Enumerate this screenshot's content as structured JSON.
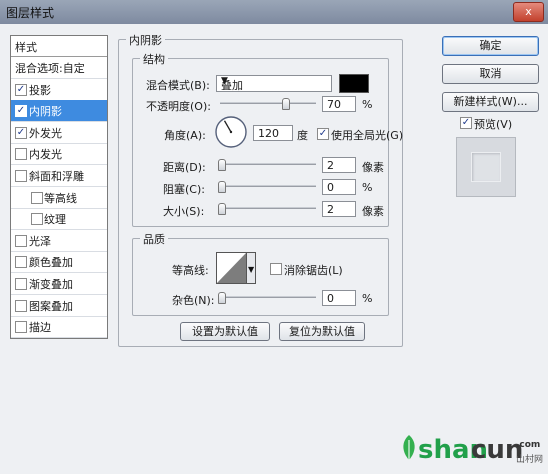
{
  "window": {
    "title": "图层样式",
    "close_label": "x"
  },
  "styles_panel": {
    "header": "样式",
    "items": [
      {
        "label": "混合选项:自定",
        "checkbox": false,
        "checked": false,
        "indent": false,
        "selected": false
      },
      {
        "label": "投影",
        "checkbox": true,
        "checked": true,
        "indent": false,
        "selected": false
      },
      {
        "label": "内阴影",
        "checkbox": true,
        "checked": true,
        "indent": false,
        "selected": true
      },
      {
        "label": "外发光",
        "checkbox": true,
        "checked": true,
        "indent": false,
        "selected": false
      },
      {
        "label": "内发光",
        "checkbox": true,
        "checked": false,
        "indent": false,
        "selected": false
      },
      {
        "label": "斜面和浮雕",
        "checkbox": true,
        "checked": false,
        "indent": false,
        "selected": false
      },
      {
        "label": "等高线",
        "checkbox": true,
        "checked": false,
        "indent": true,
        "selected": false
      },
      {
        "label": "纹理",
        "checkbox": true,
        "checked": false,
        "indent": true,
        "selected": false
      },
      {
        "label": "光泽",
        "checkbox": true,
        "checked": false,
        "indent": false,
        "selected": false
      },
      {
        "label": "颜色叠加",
        "checkbox": true,
        "checked": false,
        "indent": false,
        "selected": false
      },
      {
        "label": "渐变叠加",
        "checkbox": true,
        "checked": false,
        "indent": false,
        "selected": false
      },
      {
        "label": "图案叠加",
        "checkbox": true,
        "checked": false,
        "indent": false,
        "selected": false
      },
      {
        "label": "描边",
        "checkbox": true,
        "checked": false,
        "indent": false,
        "selected": false
      }
    ]
  },
  "inner_shadow": {
    "section_title": "内阴影",
    "structure": {
      "title": "结构",
      "blend_mode_label": "混合模式(B):",
      "blend_mode_value": "叠加",
      "shadow_color": "#000000",
      "opacity_label": "不透明度(O):",
      "opacity_value": "70",
      "opacity_unit": "%",
      "angle_label": "角度(A):",
      "angle_value": "120",
      "angle_unit": "度",
      "global_light_label": "使用全局光(G)",
      "global_light_checked": true,
      "distance_label": "距离(D):",
      "distance_value": "2",
      "distance_unit": "像素",
      "choke_label": "阻塞(C):",
      "choke_value": "0",
      "choke_unit": "%",
      "size_label": "大小(S):",
      "size_value": "2",
      "size_unit": "像素"
    },
    "quality": {
      "title": "品质",
      "contour_label": "等高线:",
      "anti_alias_label": "消除锯齿(L)",
      "anti_alias_checked": false,
      "noise_label": "杂色(N):",
      "noise_value": "0",
      "noise_unit": "%"
    },
    "make_default_label": "设置为默认值",
    "reset_default_label": "复位为默认值"
  },
  "buttons": {
    "ok": "确定",
    "cancel": "取消",
    "new_style": "新建样式(W)...",
    "preview_label": "预览(V)",
    "preview_checked": true
  },
  "watermark": {
    "shan": "shan",
    "cun": "cun",
    "com": ".com",
    "cn": "山村网"
  }
}
